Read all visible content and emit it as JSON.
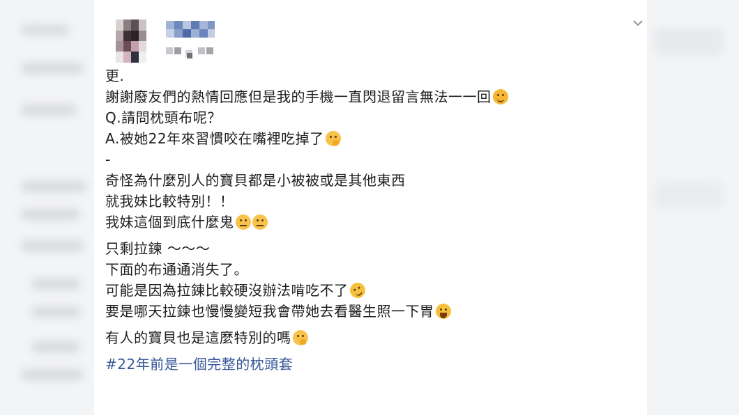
{
  "post": {
    "lines": [
      "更.",
      "謝謝廢友們的熱情回應但是我的手機一直閃退留言無法一一回",
      "Q.請問枕頭布呢？",
      "A.被她22年來習慣咬在嘴裡吃掉了",
      "-",
      "奇怪為什麼別人的寶貝都是小被被或是其他東西",
      "就我妹比較特別！！",
      "我妹這個到底什麼鬼",
      "只剩拉鍊 ～～～",
      "下面的布通通消失了。",
      "可能是因為拉鍊比較硬沒辦法啃吃不了",
      "要是哪天拉鍊也慢慢變短我會帶她去看醫生照一下胃",
      "有人的寶貝也是這麼特別的嗎"
    ],
    "hashtag": "#22年前是一個完整的枕頭套"
  },
  "icons": {
    "menu": "chevron-down-icon",
    "emoji_cry": "crying-face-emoji",
    "emoji_think": "thinking-face-emoji",
    "emoji_roll": "eye-roll-emoji",
    "emoji_rofl": "rolling-laughing-emoji",
    "emoji_laugh": "laughing-tears-emoji"
  },
  "colors": {
    "text": "#1c1e21",
    "link": "#385898",
    "background": "#ffffff"
  }
}
